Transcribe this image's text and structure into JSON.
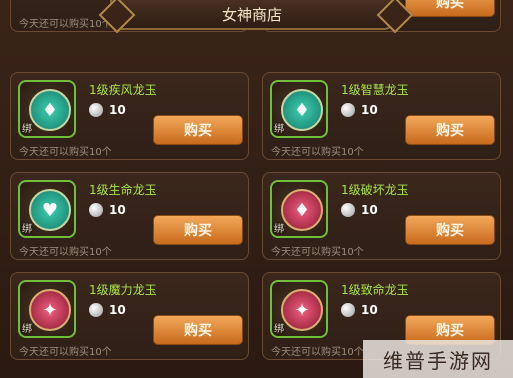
{
  "window": {
    "title": "女神商店"
  },
  "partial_row": {
    "limit_text": "今天还可以购买10个",
    "buy_label": "购买"
  },
  "items": [
    {
      "name": "1级疾风龙玉",
      "price": "10",
      "bind_label": "绑",
      "limit_text": "今天还可以购买10个",
      "buy_label": "购买",
      "gem_color": "green",
      "icon": "wind-jade-icon"
    },
    {
      "name": "1级智慧龙玉",
      "price": "10",
      "bind_label": "绑",
      "limit_text": "今天还可以购买10个",
      "buy_label": "购买",
      "gem_color": "green",
      "icon": "wisdom-jade-icon"
    },
    {
      "name": "1级生命龙玉",
      "price": "10",
      "bind_label": "绑",
      "limit_text": "今天还可以购买10个",
      "buy_label": "购买",
      "gem_color": "green",
      "icon": "life-jade-icon"
    },
    {
      "name": "1级破坏龙玉",
      "price": "10",
      "bind_label": "绑",
      "limit_text": "今天还可以购买10个",
      "buy_label": "购买",
      "gem_color": "red",
      "icon": "destruction-jade-icon"
    },
    {
      "name": "1级魔力龙玉",
      "price": "10",
      "bind_label": "绑",
      "limit_text": "今天还可以购买10个",
      "buy_label": "购买",
      "gem_color": "red",
      "icon": "magic-jade-icon"
    },
    {
      "name": "1级致命龙玉",
      "price": "10",
      "bind_label": "绑",
      "limit_text": "今天还可以购买10个",
      "buy_label": "购买",
      "gem_color": "red",
      "icon": "fatal-jade-icon"
    }
  ],
  "watermark": {
    "text": "维普手游网"
  },
  "colors": {
    "accent_green": "#a6e34a",
    "button_orange": "#e08a3a",
    "title_text": "#f3e6c8"
  }
}
